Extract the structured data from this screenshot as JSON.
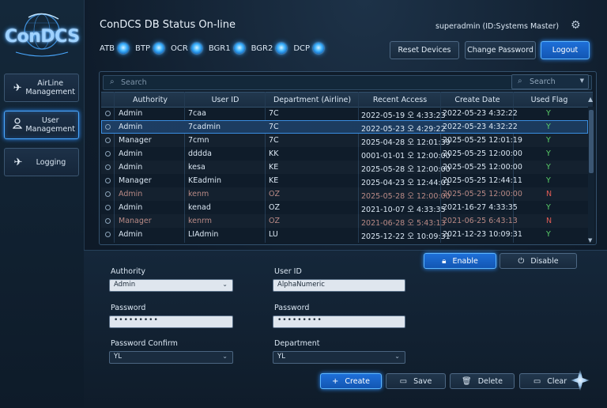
{
  "logo": {
    "text": "ConDCS"
  },
  "sidebar": {
    "items": [
      {
        "label": "AirLine Management",
        "icon": "airplane-icon"
      },
      {
        "label": "User Management",
        "icon": "user-icon",
        "active": true
      },
      {
        "label": "Logging",
        "icon": "airplane-icon"
      }
    ]
  },
  "header": {
    "status_title": "ConDCS DB Status On-line",
    "user": "superadmin (ID:Systems Master)",
    "indicators": [
      "ATB",
      "BTP",
      "OCR",
      "BGR1",
      "BGR2",
      "DCP"
    ],
    "buttons": {
      "reset": "Reset Devices",
      "change_password": "Change Password",
      "logout": "Logout"
    }
  },
  "table": {
    "search_placeholder": "Search",
    "search_right_placeholder": "Search",
    "columns": [
      "Authority",
      "User ID",
      "Department (Airline)",
      "Recent Access",
      "Create Date",
      "Used Flag"
    ],
    "rows": [
      {
        "authority": "Admin",
        "user_id": "7caa",
        "dept": "7C",
        "recent": "2022-05-19 오 4:33:23",
        "create": "2022-05-23 4:32:22",
        "flag": "Y"
      },
      {
        "authority": "Admin",
        "user_id": "7cadmin",
        "dept": "7C",
        "recent": "2022-05-23 오 4:29:22",
        "create": "2022-05-23 4:32:22",
        "flag": "Y",
        "selected": true
      },
      {
        "authority": "Manager",
        "user_id": "7cmn",
        "dept": "7C",
        "recent": "2025-04-28 오 12:01:39",
        "create": "2025-05-25 12:01:19",
        "flag": "Y"
      },
      {
        "authority": "Admin",
        "user_id": "dddda",
        "dept": "KK",
        "recent": "0001-01-01 오 12:00:00",
        "create": "2025-05-25 12:00:00",
        "flag": "Y"
      },
      {
        "authority": "Admin",
        "user_id": "kesa",
        "dept": "KE",
        "recent": "2025-05-28 오 12:00:00",
        "create": "2025-05-25 12:00:00",
        "flag": "Y"
      },
      {
        "authority": "Manager",
        "user_id": "KEadmin",
        "dept": "KE",
        "recent": "2025-04-23 오 12:44:01",
        "create": "2025-05-25 12:44:11",
        "flag": "Y"
      },
      {
        "authority": "Admin",
        "user_id": "kenm",
        "dept": "OZ",
        "recent": "2025-05-28 오 12:00:00",
        "create": "2025-05-25 12:00:00",
        "flag": "N",
        "dim": true
      },
      {
        "authority": "Admin",
        "user_id": "kenad",
        "dept": "OZ",
        "recent": "2021-10-07 오 4:33:35",
        "create": "2021-16-27 4:33:35",
        "flag": "Y"
      },
      {
        "authority": "Manager",
        "user_id": "kenrm",
        "dept": "OZ",
        "recent": "2021-06-28 오 5:43:13",
        "create": "2021-06-25 6:43:13",
        "flag": "N",
        "dim": true
      },
      {
        "authority": "Admin",
        "user_id": "LIAdmin",
        "dept": "LU",
        "recent": "2025-12-22 오 10:09:31",
        "create": "2021-12-23 10:09:31",
        "flag": "Y"
      }
    ]
  },
  "form": {
    "enable": "Enable",
    "disable": "Disable",
    "authority_label": "Authority",
    "authority_value": "Admin",
    "userid_label": "User ID",
    "userid_value": "AlphaNumeric",
    "password_label": "Password",
    "password_value": "•••••••••",
    "password2_label": "Password",
    "password2_value": "•••••••••",
    "confirm_label": "Password Confirm",
    "confirm_value": "YL",
    "department_label": "Department",
    "department_value": "YL",
    "buttons": {
      "create": "Create",
      "save": "Save",
      "delete": "Delete",
      "clear": "Clear"
    }
  },
  "colors": {
    "accent": "#2e8fff",
    "flag_yes": "#5bd36a",
    "flag_no": "#e05b55"
  }
}
